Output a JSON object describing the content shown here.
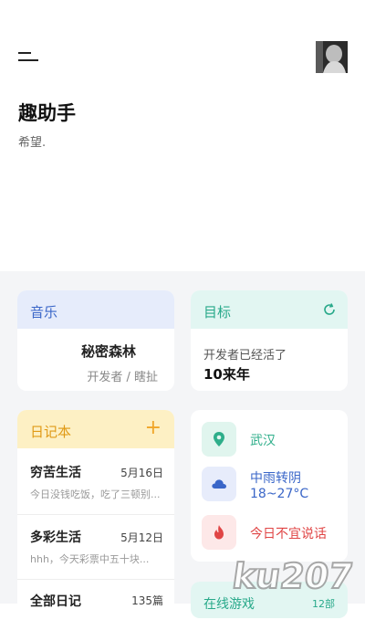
{
  "header": {
    "title": "趣助手",
    "subtitle": "希望."
  },
  "music": {
    "title": "音乐",
    "song": "秘密森林",
    "artist": "开发者 / 瞎扯"
  },
  "goal": {
    "title": "目标",
    "text": "开发者已经活了",
    "value": "10来年"
  },
  "diary": {
    "title": "日记本",
    "add_label": "+",
    "entries": [
      {
        "title": "穷苦生活",
        "date": "5月16日",
        "snippet": "今日没钱吃饭，吃了三顿别..."
      },
      {
        "title": "多彩生活",
        "date": "5月12日",
        "snippet": "hhh，今天彩票中五十块..."
      }
    ],
    "all_label": "全部日记",
    "all_count": "135篇"
  },
  "info": {
    "location": "武汉",
    "weather_desc": "中雨转阴",
    "weather_temp": "18~27°C",
    "note": "今日不宜说话"
  },
  "games": {
    "title": "在线游戏",
    "count": "12部"
  },
  "watermark": "ku207",
  "colors": {
    "music_accent": "#3a66c8",
    "goal_accent": "#28a98a",
    "diary_accent": "#e09a16",
    "note_accent": "#e04545",
    "background": "#f4f5f7"
  },
  "icons": {
    "menu": "menu-icon",
    "refresh": "refresh-icon",
    "location": "location-pin-icon",
    "weather": "cloud-icon",
    "note": "flame-icon"
  }
}
